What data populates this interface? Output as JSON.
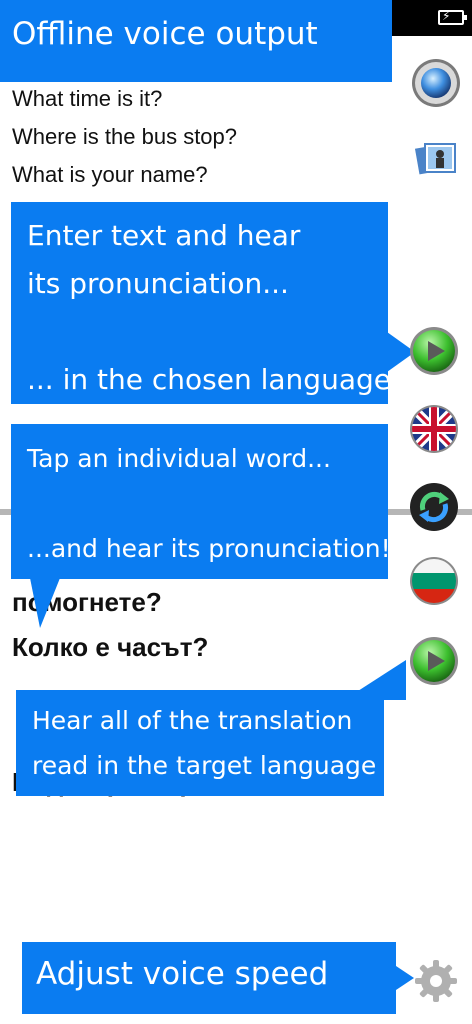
{
  "title": "Offline voice output",
  "source_text": {
    "lines": [
      "What time is it?",
      "Where is the bus stop?",
      "What is your name?"
    ]
  },
  "target_text": {
    "lines": [
      "помогнете?",
      "Колко е часът?",
      "Къде е ресторантът?"
    ]
  },
  "callouts": {
    "enter_text": {
      "lines": [
        "Enter text and hear",
        "its pronunciation...",
        "",
        "... in the chosen language!"
      ]
    },
    "tap_word": {
      "lines": [
        "Tap an individual word...",
        "",
        "...and hear its pronunciation!"
      ]
    },
    "hear_all": {
      "lines": [
        "Hear all of the translation",
        "read in the target language"
      ]
    },
    "voice_speed": {
      "text": "Adjust voice speed"
    }
  },
  "icons": {
    "record": "record-icon",
    "photo": "photo-icon",
    "play_source": "play-icon",
    "source_flag": "uk-flag-icon",
    "swap": "swap-languages-icon",
    "target_flag": "bulgaria-flag-icon",
    "play_target": "play-icon",
    "settings": "gear-icon"
  },
  "colors": {
    "callout": "#0a7cf1",
    "play_green": "#3cbf2e"
  }
}
